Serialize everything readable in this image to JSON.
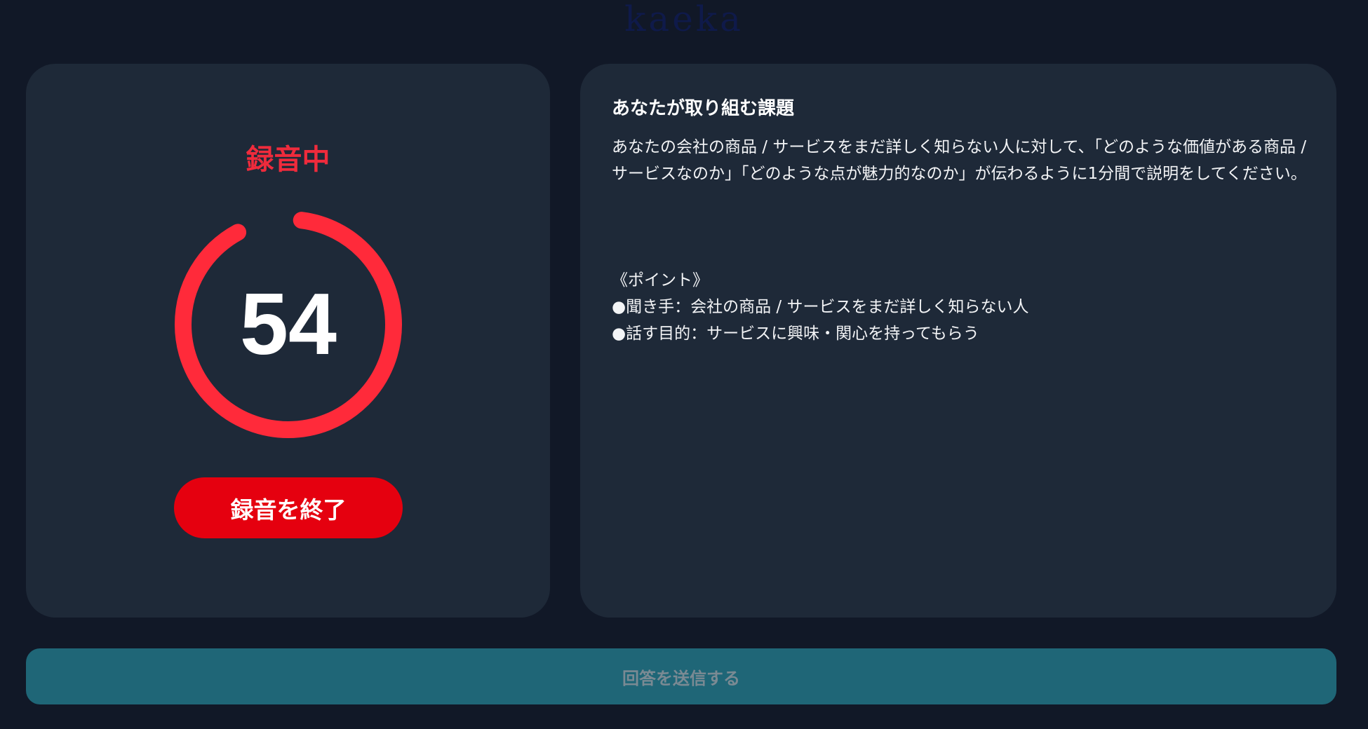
{
  "logo_text": "kaeka",
  "recorder": {
    "status": "録音中",
    "seconds_remaining": "54",
    "progress_fraction": 0.9,
    "stop_label": "録音を終了",
    "ring_color": "#ff2a3a",
    "button_color": "#e5000f"
  },
  "task": {
    "title": "あなたが取り組む課題",
    "description": "あなたの会社の商品 / サービスをまだ詳しく知らない人に対して、「どのような価値がある商品 / サービスなのか」「どのような点が魅力的なのか」が伝わるように1分間で説明をしてください。",
    "points_heading": "《ポイント》",
    "points": [
      "●聞き手：会社の商品 / サービスをまだ詳しく知らない人",
      "●話す目的：サービスに興味・関心を持ってもらう"
    ]
  },
  "submit": {
    "label": "回答を送信する"
  },
  "colors": {
    "background": "#111827",
    "card": "#1e2938",
    "accent_red": "#ef2b3c",
    "submit_disabled": "#1f6677"
  }
}
